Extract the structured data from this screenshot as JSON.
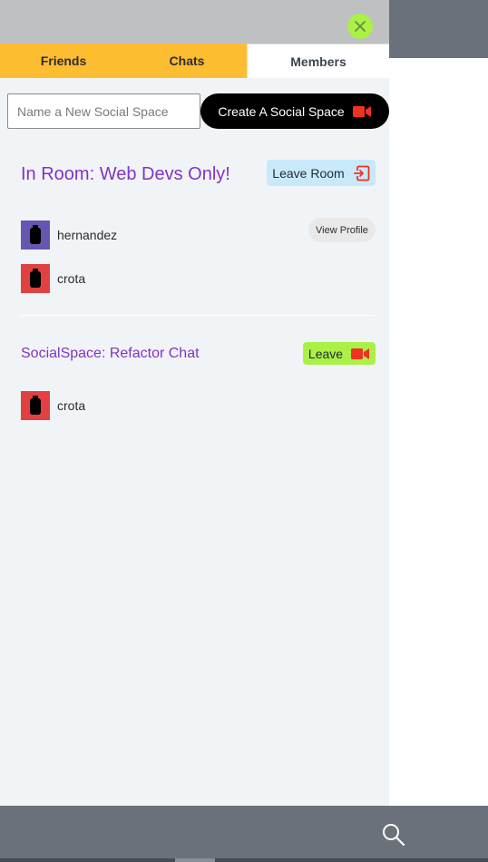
{
  "tabs": [
    {
      "label": "Friends"
    },
    {
      "label": "Chats"
    },
    {
      "label": "Members",
      "active": true
    }
  ],
  "new_space": {
    "placeholder": "Name a New Social Space",
    "value": "",
    "create_label": "Create A Social Space"
  },
  "room": {
    "title": "In Room: Web Devs Only!",
    "leave_label": "Leave Room",
    "members": [
      {
        "name": "hernandez",
        "avatar_color": "#6656b0"
      },
      {
        "name": "crota",
        "avatar_color": "#e14141"
      }
    ],
    "view_profile_label": "View Profile"
  },
  "social_space": {
    "title": "SocialSpace: Refactor Chat",
    "leave_label": "Leave",
    "members": [
      {
        "name": "crota",
        "avatar_color": "#e14141"
      }
    ]
  },
  "colors": {
    "accent_purple": "#8233c5",
    "tab_yellow": "#fdbd31",
    "lime": "#aaf046",
    "video_red": "#ee3322",
    "bar_gray": "#6b717a"
  },
  "icons": {
    "close": "close-icon",
    "video": "video-camera-icon",
    "exit": "exit-door-icon",
    "avatar": "user-silhouette-icon",
    "search": "search-icon"
  }
}
